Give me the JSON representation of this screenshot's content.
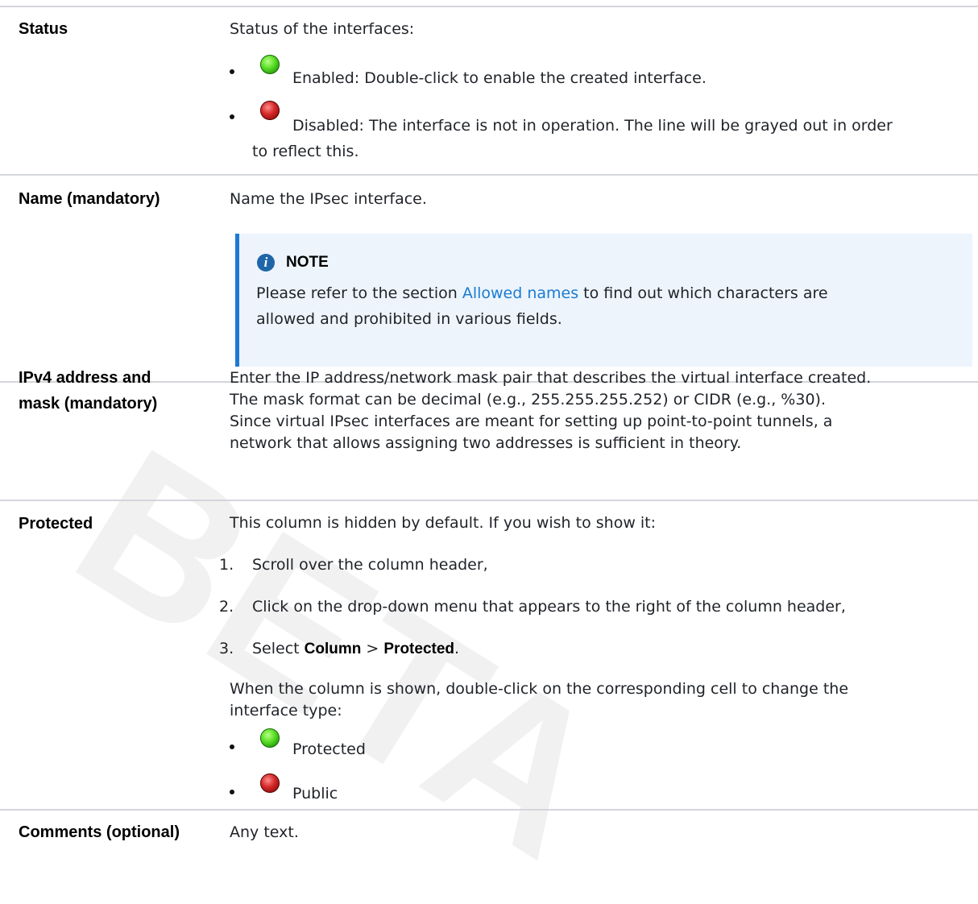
{
  "watermark": "BETA",
  "rows": [
    {
      "term": "Status",
      "intro": "Status of the interfaces:",
      "items": [
        {
          "icon": "green-status-icon",
          "text": "Enabled: Double-click to enable the created interface."
        },
        {
          "icon": "red-status-icon",
          "text_line1": "Disabled: The interface is not in operation. The line will be grayed out in order",
          "text_line2": "to reflect this."
        }
      ]
    },
    {
      "term": "Name (mandatory)",
      "text": "Name the IPsec interface.",
      "note": {
        "title": "NOTE",
        "line1_before": "Please refer to the section ",
        "link": "Allowed names",
        "line1_after": " to find out which characters are",
        "line2": "allowed and prohibited in various fields."
      }
    },
    {
      "term_line1": "IPv4 address and",
      "term_line2": "mask (mandatory)",
      "lines": [
        "Enter the IP address/network mask pair that describes the virtual interface created.",
        "The mask format can be decimal (e.g., 255.255.255.252) or CIDR (e.g., %30).",
        "Since virtual IPsec interfaces are meant for setting up point-to-point tunnels, a",
        "network that allows assigning two addresses is sufficient in theory."
      ]
    },
    {
      "term": "Protected",
      "intro": "This column is hidden by default. If you wish to show it:",
      "steps": [
        {
          "num": "1.",
          "text": "Scroll over the column header,"
        },
        {
          "num": "2.",
          "text": "Click on the drop-down menu that appears to the right of the column header,"
        },
        {
          "num": "3.",
          "text_before": "Select ",
          "bold1": "Column",
          "sep": " > ",
          "bold2": "Protected",
          "text_after": "."
        }
      ],
      "after_line1": "When the column is shown, double-click on the corresponding cell to change the",
      "after_line2": "interface type:",
      "items": [
        {
          "icon": "green-status-icon",
          "text": "Protected"
        },
        {
          "icon": "red-status-icon",
          "text": "Public"
        }
      ]
    },
    {
      "term": "Comments (optional)",
      "text": "Any text."
    }
  ]
}
